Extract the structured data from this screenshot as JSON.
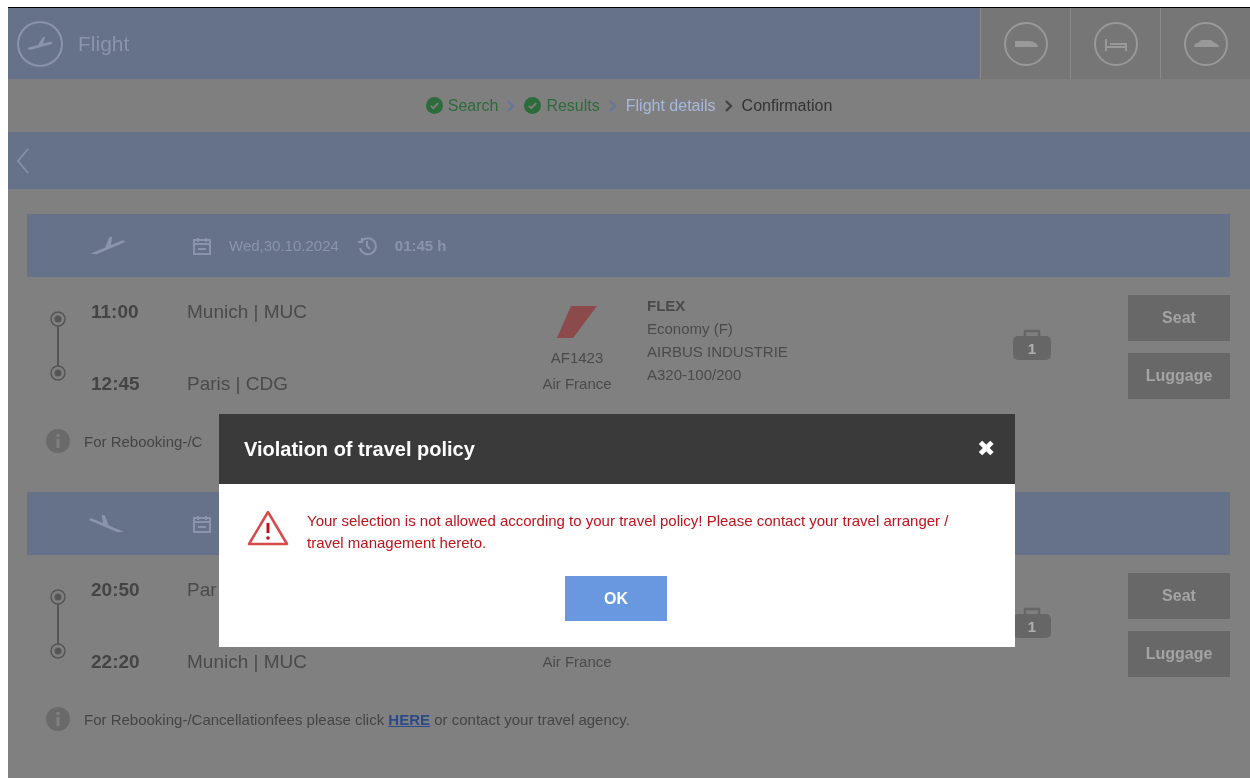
{
  "header": {
    "title": "Flight"
  },
  "breadcrumb": [
    {
      "label": "Search",
      "completed": true,
      "selected": false
    },
    {
      "label": "Results",
      "completed": true,
      "selected": false
    },
    {
      "label": "Flight details",
      "completed": false,
      "selected": true
    },
    {
      "label": "Confirmation",
      "completed": false,
      "selected": false
    }
  ],
  "segments": [
    {
      "kind": "outbound",
      "date": "Wed,30.10.2024",
      "duration": "01:45 h",
      "departure_time": "11:00",
      "departure_place": "Munich | MUC",
      "arrival_time": "12:45",
      "arrival_place": "Paris | CDG",
      "flight_number": "AF1423",
      "airline": "Air France",
      "fare": "FLEX",
      "details": [
        "Economy (F)",
        "AIRBUS INDUSTRIE",
        "A320-100/200"
      ],
      "luggage_count": "1",
      "buttons": [
        "Seat",
        "Luggage"
      ],
      "info": {
        "text": "For Rebooking-/C"
      }
    },
    {
      "kind": "return",
      "departure_time": "20:50",
      "departure_place": "Par",
      "arrival_time": "22:20",
      "arrival_place": "Munich | MUC",
      "airline": "Air France",
      "luggage_count": "1",
      "buttons": [
        "Seat",
        "Luggage"
      ],
      "info": {
        "text": "For Rebooking-/Cancellationfees please click",
        "link": "HERE",
        "after": "or contact your travel agency."
      }
    }
  ],
  "dialog": {
    "title": "Violation of travel policy",
    "close": "✖",
    "message": "Your selection is not allowed according to your travel policy! Please contact your travel arranger / travel management hereto.",
    "button": "OK"
  }
}
